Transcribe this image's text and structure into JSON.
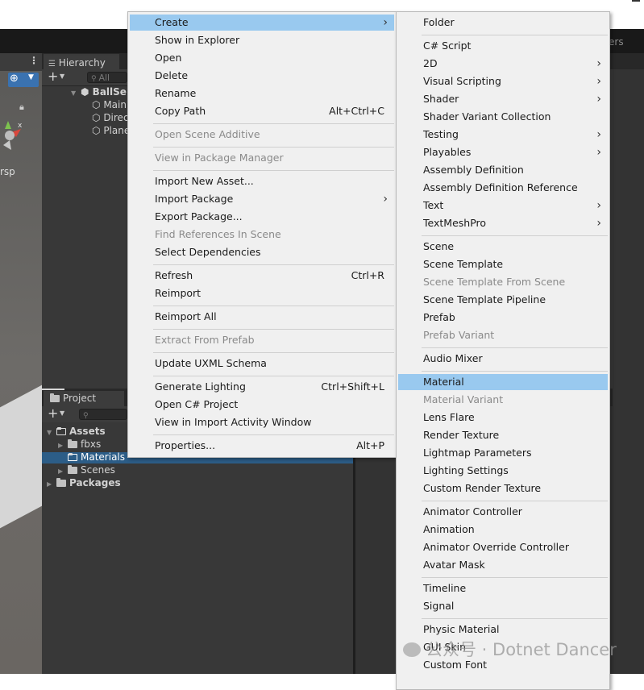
{
  "hierarchy": {
    "tab": "Hierarchy",
    "search_placeholder": "All",
    "scene_name": "BallSe",
    "children": [
      "Main",
      "Direc",
      "Plane"
    ]
  },
  "scene_view": {
    "persp_label": "rsp"
  },
  "partial_right_label": "ers",
  "project": {
    "tab": "Project",
    "tree": {
      "assets": "Assets",
      "fbxs": "fbxs",
      "materials": "Materials",
      "scenes": "Scenes",
      "packages": "Packages"
    }
  },
  "main_menu": {
    "items": [
      {
        "label": "Create",
        "shortcut": "",
        "submenu": true,
        "disabled": false,
        "highlight": true
      },
      {
        "label": "Show in Explorer",
        "shortcut": "",
        "submenu": false,
        "disabled": false
      },
      {
        "label": "Open",
        "shortcut": "",
        "submenu": false,
        "disabled": false
      },
      {
        "label": "Delete",
        "shortcut": "",
        "submenu": false,
        "disabled": false
      },
      {
        "label": "Rename",
        "shortcut": "",
        "submenu": false,
        "disabled": false
      },
      {
        "label": "Copy Path",
        "shortcut": "Alt+Ctrl+C",
        "submenu": false,
        "disabled": false
      },
      {
        "label": "Open Scene Additive",
        "shortcut": "",
        "submenu": false,
        "disabled": true
      },
      {
        "label": "View in Package Manager",
        "shortcut": "",
        "submenu": false,
        "disabled": true
      },
      {
        "label": "Import New Asset...",
        "shortcut": "",
        "submenu": false,
        "disabled": false
      },
      {
        "label": "Import Package",
        "shortcut": "",
        "submenu": true,
        "disabled": false
      },
      {
        "label": "Export Package...",
        "shortcut": "",
        "submenu": false,
        "disabled": false
      },
      {
        "label": "Find References In Scene",
        "shortcut": "",
        "submenu": false,
        "disabled": true
      },
      {
        "label": "Select Dependencies",
        "shortcut": "",
        "submenu": false,
        "disabled": false
      },
      {
        "label": "Refresh",
        "shortcut": "Ctrl+R",
        "submenu": false,
        "disabled": false
      },
      {
        "label": "Reimport",
        "shortcut": "",
        "submenu": false,
        "disabled": false
      },
      {
        "label": "Reimport All",
        "shortcut": "",
        "submenu": false,
        "disabled": false
      },
      {
        "label": "Extract From Prefab",
        "shortcut": "",
        "submenu": false,
        "disabled": true
      },
      {
        "label": "Update UXML Schema",
        "shortcut": "",
        "submenu": false,
        "disabled": false
      },
      {
        "label": "Generate Lighting",
        "shortcut": "Ctrl+Shift+L",
        "submenu": false,
        "disabled": false
      },
      {
        "label": "Open C# Project",
        "shortcut": "",
        "submenu": false,
        "disabled": false
      },
      {
        "label": "View in Import Activity Window",
        "shortcut": "",
        "submenu": false,
        "disabled": false
      },
      {
        "label": "Properties...",
        "shortcut": "Alt+P",
        "submenu": false,
        "disabled": false
      }
    ]
  },
  "create_submenu": {
    "items": [
      {
        "label": "Folder",
        "submenu": false,
        "disabled": false
      },
      {
        "label": "C# Script",
        "submenu": false,
        "disabled": false
      },
      {
        "label": "2D",
        "submenu": true,
        "disabled": false
      },
      {
        "label": "Visual Scripting",
        "submenu": true,
        "disabled": false
      },
      {
        "label": "Shader",
        "submenu": true,
        "disabled": false
      },
      {
        "label": "Shader Variant Collection",
        "submenu": false,
        "disabled": false
      },
      {
        "label": "Testing",
        "submenu": true,
        "disabled": false
      },
      {
        "label": "Playables",
        "submenu": true,
        "disabled": false
      },
      {
        "label": "Assembly Definition",
        "submenu": false,
        "disabled": false
      },
      {
        "label": "Assembly Definition Reference",
        "submenu": false,
        "disabled": false
      },
      {
        "label": "Text",
        "submenu": true,
        "disabled": false
      },
      {
        "label": "TextMeshPro",
        "submenu": true,
        "disabled": false
      },
      {
        "label": "Scene",
        "submenu": false,
        "disabled": false
      },
      {
        "label": "Scene Template",
        "submenu": false,
        "disabled": false
      },
      {
        "label": "Scene Template From Scene",
        "submenu": false,
        "disabled": true
      },
      {
        "label": "Scene Template Pipeline",
        "submenu": false,
        "disabled": false
      },
      {
        "label": "Prefab",
        "submenu": false,
        "disabled": false
      },
      {
        "label": "Prefab Variant",
        "submenu": false,
        "disabled": true
      },
      {
        "label": "Audio Mixer",
        "submenu": false,
        "disabled": false
      },
      {
        "label": "Material",
        "submenu": false,
        "disabled": false,
        "highlight": true
      },
      {
        "label": "Material Variant",
        "submenu": false,
        "disabled": true
      },
      {
        "label": "Lens Flare",
        "submenu": false,
        "disabled": false
      },
      {
        "label": "Render Texture",
        "submenu": false,
        "disabled": false
      },
      {
        "label": "Lightmap Parameters",
        "submenu": false,
        "disabled": false
      },
      {
        "label": "Lighting Settings",
        "submenu": false,
        "disabled": false
      },
      {
        "label": "Custom Render Texture",
        "submenu": false,
        "disabled": false
      },
      {
        "label": "Animator Controller",
        "submenu": false,
        "disabled": false
      },
      {
        "label": "Animation",
        "submenu": false,
        "disabled": false
      },
      {
        "label": "Animator Override Controller",
        "submenu": false,
        "disabled": false
      },
      {
        "label": "Avatar Mask",
        "submenu": false,
        "disabled": false
      },
      {
        "label": "Timeline",
        "submenu": false,
        "disabled": false
      },
      {
        "label": "Signal",
        "submenu": false,
        "disabled": false
      },
      {
        "label": "Physic Material",
        "submenu": false,
        "disabled": false
      },
      {
        "label": "GUI Skin",
        "submenu": false,
        "disabled": false
      },
      {
        "label": "Custom Font",
        "submenu": false,
        "disabled": false
      }
    ]
  },
  "watermark": "公众号 · Dotnet Dancer",
  "colors": {
    "menu_bg": "#f0f0f0",
    "menu_highlight": "#99c9ef",
    "disabled_text": "#8a8a8a",
    "editor_dark": "#282828",
    "selection_blue": "#2c5d87"
  }
}
